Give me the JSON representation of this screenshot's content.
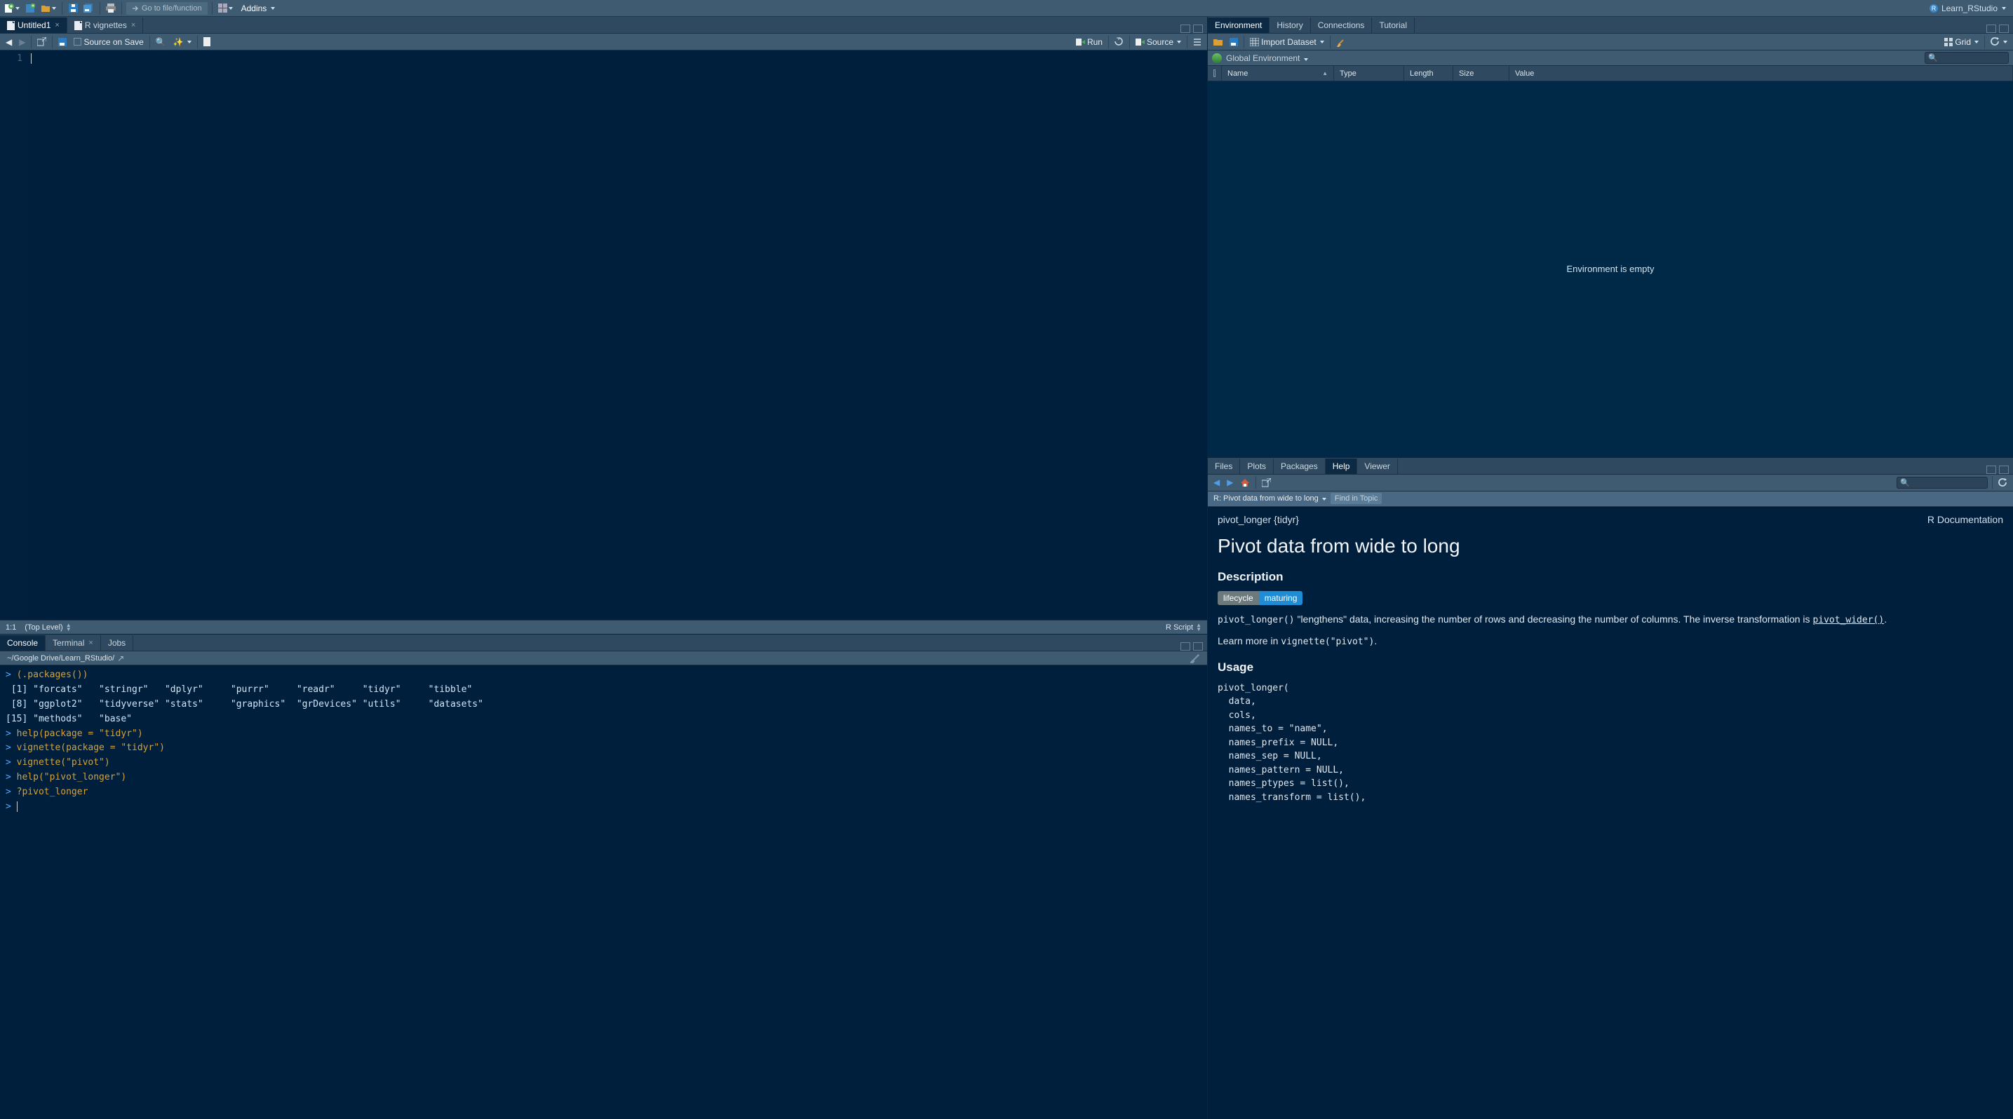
{
  "topbar": {
    "goto_placeholder": "Go to file/function",
    "addins_label": "Addins",
    "project_label": "Learn_RStudio"
  },
  "source": {
    "tabs": [
      {
        "label": "Untitled1",
        "closable": true,
        "active": true
      },
      {
        "label": "R vignettes",
        "closable": true,
        "active": false
      }
    ],
    "sourceonsave_label": "Source on Save",
    "run_label": "Run",
    "source_label": "Source",
    "line_number": "1",
    "status_pos": "1:1",
    "status_scope": "(Top Level)",
    "status_type": "R Script"
  },
  "consolepane": {
    "tabs": [
      "Console",
      "Terminal",
      "Jobs"
    ],
    "active_tab": "Console",
    "path": "~/Google Drive/Learn_RStudio/",
    "lines": [
      {
        "t": "cmd",
        "text": "(.packages())"
      },
      {
        "t": "out",
        "text": " [1] \"forcats\"   \"stringr\"   \"dplyr\"     \"purrr\"     \"readr\"     \"tidyr\"     \"tibble\"   "
      },
      {
        "t": "out",
        "text": " [8] \"ggplot2\"   \"tidyverse\" \"stats\"     \"graphics\"  \"grDevices\" \"utils\"     \"datasets\" "
      },
      {
        "t": "out",
        "text": "[15] \"methods\"   \"base\"     "
      },
      {
        "t": "cmd",
        "text": "help(package = \"tidyr\")"
      },
      {
        "t": "cmd",
        "text": "vignette(package = \"tidyr\")"
      },
      {
        "t": "cmd",
        "text": "vignette(\"pivot\")"
      },
      {
        "t": "cmd",
        "text": "help(\"pivot_longer\")"
      },
      {
        "t": "cmd",
        "text": "?pivot_longer"
      },
      {
        "t": "prompt",
        "text": ""
      }
    ]
  },
  "env": {
    "tabs": [
      "Environment",
      "History",
      "Connections",
      "Tutorial"
    ],
    "active_tab": "Environment",
    "import_label": "Import Dataset",
    "view_label": "Grid",
    "scope_label": "Global Environment",
    "columns": [
      "Name",
      "Type",
      "Length",
      "Size",
      "Value"
    ],
    "empty_label": "Environment is empty"
  },
  "help": {
    "tabs": [
      "Files",
      "Plots",
      "Packages",
      "Help",
      "Viewer"
    ],
    "active_tab": "Help",
    "crumb_label": "R: Pivot data from wide to long",
    "find_placeholder": "Find in Topic",
    "doc_left": "pivot_longer {tidyr}",
    "doc_right": "R Documentation",
    "title": "Pivot data from wide to long",
    "h_description": "Description",
    "badge_left": "lifecycle",
    "badge_right": "maturing",
    "desc_code1": "pivot_longer()",
    "desc_text1": " \"lengthens\" data, increasing the number of rows and decreasing the number of columns. The inverse transformation is ",
    "desc_link": "pivot_wider()",
    "learn_text": "Learn more in ",
    "learn_code": "vignette(\"pivot\")",
    "h_usage": "Usage",
    "usage_text": "pivot_longer(\n  data,\n  cols,\n  names_to = \"name\",\n  names_prefix = NULL,\n  names_sep = NULL,\n  names_pattern = NULL,\n  names_ptypes = list(),\n  names_transform = list(),"
  }
}
